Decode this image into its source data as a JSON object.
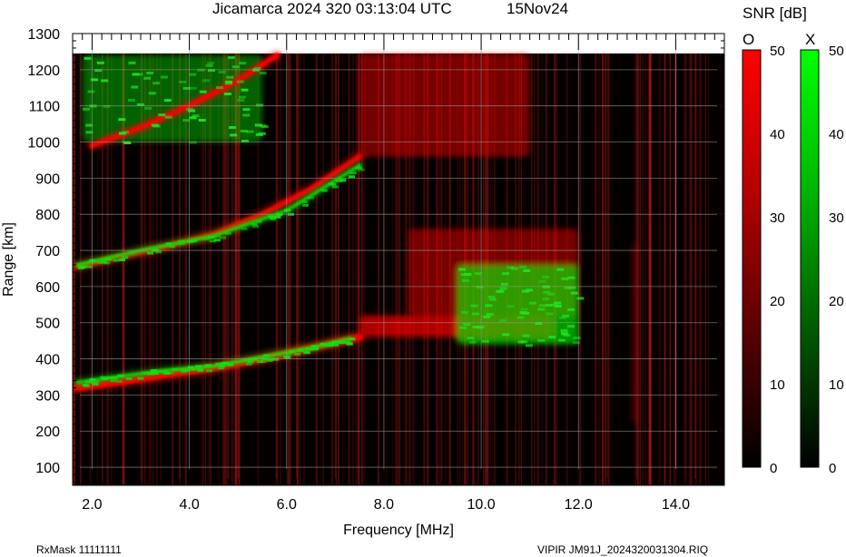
{
  "header": {
    "title": "Jicamarca 2024 320 03:13:04 UTC",
    "date": "15Nov24"
  },
  "footer": {
    "left": "RxMask 11111111",
    "right": "VIPIR  JM91J_2024320031304.RIQ"
  },
  "colorbars": {
    "title": "SNR [dB]",
    "o_label": "O",
    "x_label": "X",
    "ticks": [
      "50",
      "40",
      "30",
      "20",
      "10",
      "0"
    ],
    "o_colors": [
      "#000000",
      "#5a0000",
      "#b40000",
      "#ff0000"
    ],
    "x_colors": [
      "#000000",
      "#005a00",
      "#00b400",
      "#00ff00"
    ]
  },
  "chart_data": {
    "type": "heatmap",
    "title": "",
    "xlabel": "Frequency [MHz]",
    "ylabel": "Range [km]",
    "xlim": [
      1.6,
      15.0
    ],
    "ylim": [
      50,
      1300
    ],
    "xticks": [
      "2.0",
      "4.0",
      "6.0",
      "8.0",
      "10.0",
      "12.0",
      "14.0"
    ],
    "xtick_values": [
      2,
      4,
      6,
      8,
      10,
      12,
      14
    ],
    "yticks": [
      "100",
      "200",
      "300",
      "400",
      "500",
      "600",
      "700",
      "800",
      "900",
      "1000",
      "1100",
      "1200",
      "1300"
    ],
    "ytick_values": [
      100,
      200,
      300,
      400,
      500,
      600,
      700,
      800,
      900,
      1000,
      1100,
      1200,
      1300
    ],
    "data_range_max_km": 1245,
    "grid": true,
    "colorbar_units": "SNR [dB]",
    "colorbar_range": [
      0,
      50
    ],
    "series": [
      {
        "mode": "O",
        "color": "#ff0000",
        "trace_1hop": {
          "x": [
            1.7,
            2.5,
            3.5,
            4.5,
            5.5,
            6.5,
            7.0,
            7.5
          ],
          "y": [
            320,
            335,
            355,
            375,
            400,
            430,
            445,
            460
          ]
        },
        "trace_2hop": {
          "x": [
            1.7,
            2.5,
            3.5,
            4.5,
            5.5,
            6.5,
            7.5
          ],
          "y": [
            655,
            680,
            710,
            745,
            800,
            870,
            960
          ]
        },
        "trace_3hop": {
          "x": [
            2.0,
            3.0,
            4.0,
            5.0,
            5.8
          ],
          "y": [
            990,
            1040,
            1100,
            1170,
            1240
          ]
        },
        "diffuse_zones": [
          {
            "x": [
              7.5,
              11.5
            ],
            "y": [
              460,
              520
            ],
            "snr": 45
          },
          {
            "x": [
              8.5,
              12.0
            ],
            "y": [
              520,
              760
            ],
            "snr": 30
          },
          {
            "x": [
              7.5,
              11.0
            ],
            "y": [
              960,
              1245
            ],
            "snr": 30
          },
          {
            "x": [
              13.1,
              13.2
            ],
            "y": [
              220,
              720
            ],
            "snr": 20
          }
        ]
      },
      {
        "mode": "X",
        "color": "#00ff00",
        "trace_1hop": {
          "x": [
            1.7,
            2.5,
            3.5,
            4.5,
            5.5,
            6.5,
            7.3
          ],
          "y": [
            335,
            350,
            368,
            380,
            405,
            430,
            455
          ]
        },
        "trace_2hop": {
          "x": [
            1.7,
            3.0,
            4.5,
            6.0,
            7.5
          ],
          "y": [
            660,
            700,
            740,
            810,
            935
          ]
        },
        "diffuse_zones": [
          {
            "x": [
              9.5,
              12.0
            ],
            "y": [
              440,
              660
            ],
            "snr": 40
          },
          {
            "x": [
              1.8,
              5.5
            ],
            "y": [
              1000,
              1240
            ],
            "snr": 25
          }
        ]
      }
    ]
  }
}
